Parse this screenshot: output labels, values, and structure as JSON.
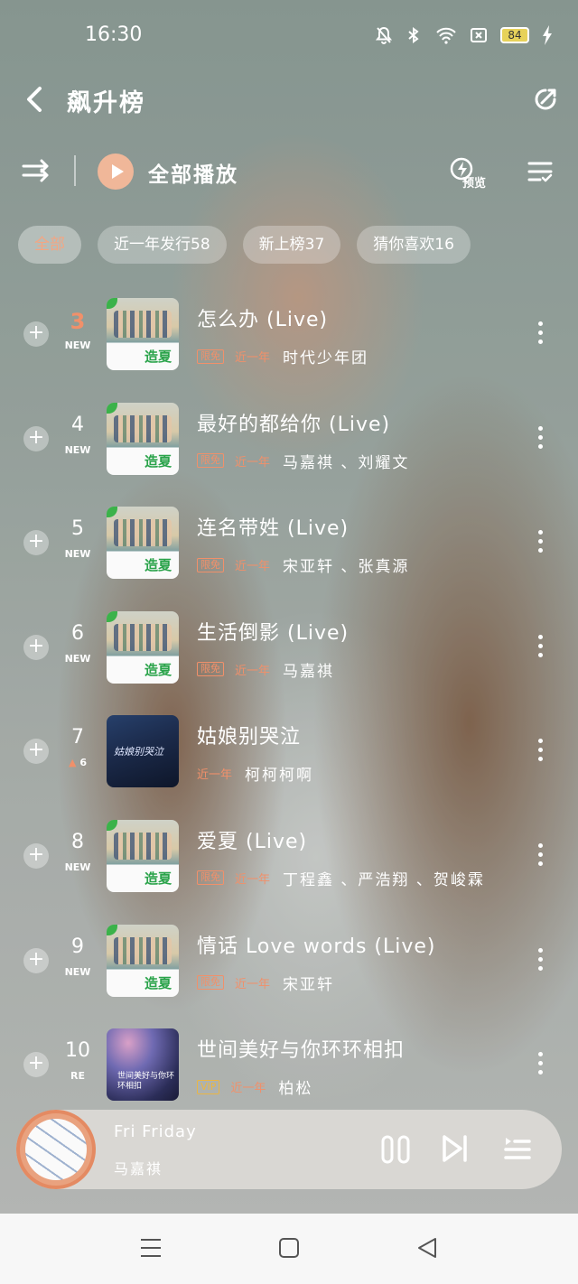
{
  "status": {
    "time": "16:30",
    "battery": "84"
  },
  "header": {
    "title": "飙升榜"
  },
  "play": {
    "label": "全部播放",
    "preview": "预览"
  },
  "filters": [
    {
      "label": "全部",
      "active": true
    },
    {
      "label": "近一年发行58"
    },
    {
      "label": "新上榜37"
    },
    {
      "label": "猜你喜欢16"
    }
  ],
  "songs": [
    {
      "rank": "3",
      "badge": "NEW",
      "title": "怎么办 (Live)",
      "tag": "限免",
      "recent": "近一年",
      "artists": "时代少年团",
      "cover": "summer",
      "cover_text": "造夏"
    },
    {
      "rank": "4",
      "badge": "NEW",
      "title": "最好的都给你 (Live)",
      "tag": "限免",
      "recent": "近一年",
      "artists": "马嘉祺 、刘耀文",
      "cover": "summer",
      "cover_text": "造夏"
    },
    {
      "rank": "5",
      "badge": "NEW",
      "title": "连名带姓 (Live)",
      "tag": "限免",
      "recent": "近一年",
      "artists": "宋亚轩 、张真源",
      "cover": "summer",
      "cover_text": "造夏"
    },
    {
      "rank": "6",
      "badge": "NEW",
      "title": "生活倒影 (Live)",
      "tag": "限免",
      "recent": "近一年",
      "artists": "马嘉祺",
      "cover": "summer",
      "cover_text": "造夏"
    },
    {
      "rank": "7",
      "badge": "6",
      "title": "姑娘别哭泣",
      "tag": "",
      "recent": "近一年",
      "artists": "柯柯柯啊",
      "cover": "night",
      "cover_text": "姑娘别哭泣"
    },
    {
      "rank": "8",
      "badge": "NEW",
      "title": "爱夏 (Live)",
      "tag": "限免",
      "recent": "近一年",
      "artists": "丁程鑫 、严浩翔 、贺峻霖",
      "cover": "summer",
      "cover_text": "造夏"
    },
    {
      "rank": "9",
      "badge": "NEW",
      "title": "情话 Love words (Live)",
      "tag": "限免",
      "recent": "近一年",
      "artists": "宋亚轩",
      "cover": "summer",
      "cover_text": "造夏"
    },
    {
      "rank": "10",
      "badge": "RE",
      "title": "世间美好与你环环相扣",
      "tag": "VIP",
      "recent": "近一年",
      "artists": "柏松",
      "cover": "galaxy",
      "cover_text": "世间美好与你环环相扣"
    }
  ],
  "player": {
    "title": "Fri Friday",
    "artist": "马嘉祺"
  }
}
